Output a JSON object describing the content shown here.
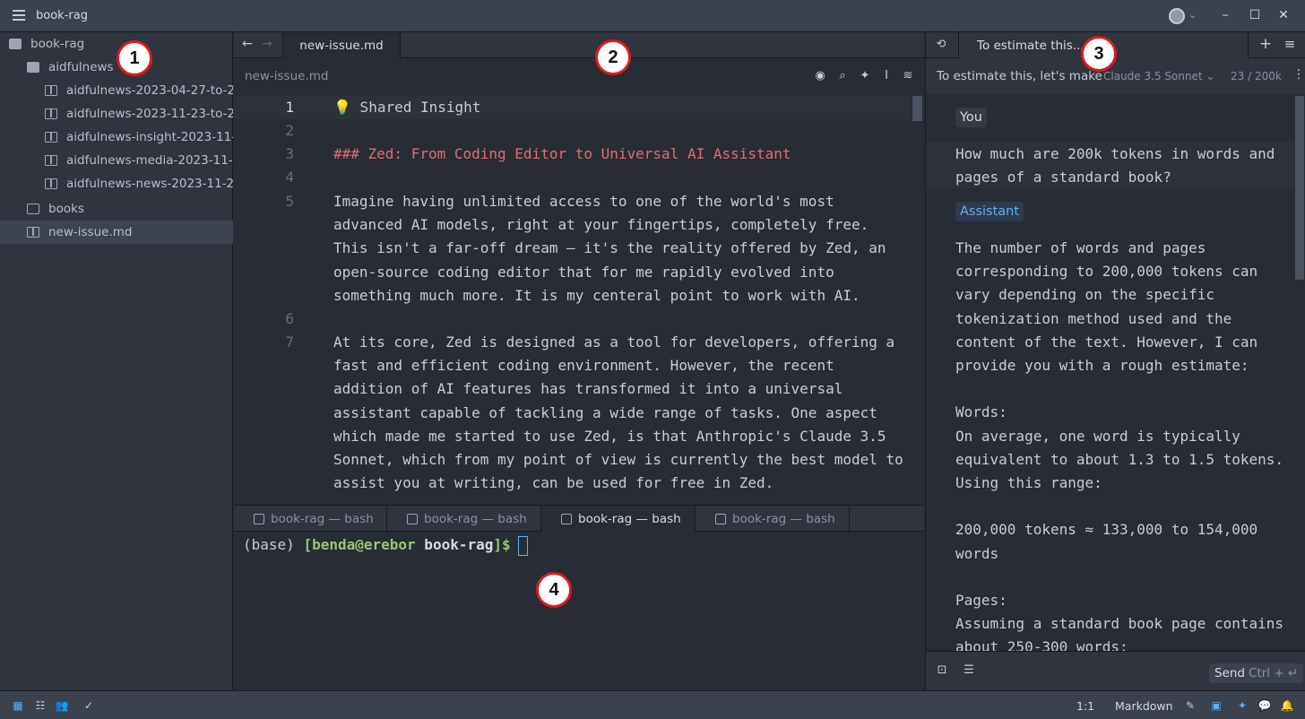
{
  "window": {
    "title": "book-rag"
  },
  "sidebar": {
    "items": [
      {
        "label": "book-rag",
        "kind": "folder"
      },
      {
        "label": "aidfulnews",
        "kind": "folder"
      },
      {
        "label": "aidfulnews-2023-04-27-to-2",
        "kind": "file"
      },
      {
        "label": "aidfulnews-2023-11-23-to-2",
        "kind": "file"
      },
      {
        "label": "aidfulnews-insight-2023-11-",
        "kind": "file"
      },
      {
        "label": "aidfulnews-media-2023-11-2",
        "kind": "file"
      },
      {
        "label": "aidfulnews-news-2023-11-23",
        "kind": "file"
      },
      {
        "label": "books",
        "kind": "folder"
      },
      {
        "label": "new-issue.md",
        "kind": "file"
      }
    ]
  },
  "editor": {
    "tab_label": "new-issue.md",
    "breadcrumb": "new-issue.md",
    "lines": [
      {
        "num": "1",
        "text": "💡 Shared Insight"
      },
      {
        "num": "2",
        "text": ""
      },
      {
        "num": "3",
        "text": "### Zed: From Coding Editor to Universal AI Assistant"
      },
      {
        "num": "4",
        "text": ""
      },
      {
        "num": "5",
        "text": "Imagine having unlimited access to one of the world's most advanced AI models, right at your fingertips, completely free. This isn't a far-off dream – it's the reality offered by Zed, an open-source coding editor that for me rapidly evolved into something much more. It is my centeral point to work with AI."
      },
      {
        "num": "6",
        "text": ""
      },
      {
        "num": "7",
        "text": "At its core, Zed is designed as a tool for developers, offering a fast and efficient coding environment. However, the recent addition of AI features has transformed it into a universal assistant capable of tackling a wide range of tasks. One aspect which made me started to use Zed, is that Anthropic's Claude 3.5 Sonnet, which from my point of view is currently the best model to assist you at writing, can be used for free in Zed."
      }
    ]
  },
  "terminal": {
    "tabs": [
      "book-rag — bash",
      "book-rag — bash",
      "book-rag — bash",
      "book-rag — bash"
    ],
    "prompt_base": "(base) ",
    "prompt_open": "[",
    "prompt_user": "benda@erebor",
    "prompt_dir": " book-rag",
    "prompt_close": "]$"
  },
  "assistant": {
    "tab_label": "To estimate this...",
    "title": "To estimate this, let's make",
    "model": "Claude 3.5 Sonnet",
    "token_count": "23 / 200k",
    "user_role": "You",
    "user_message": "How much are 200k tokens in words and pages of a standard book?",
    "assistant_role": "Assistant",
    "assistant_message": "The number of words and pages corresponding to 200,000 tokens can vary depending on the specific tokenization method used and the content of the text. However, I can provide you with a rough estimate:\n\nWords:\nOn average, one word is typically equivalent to about 1.3 to 1.5 tokens. Using this range:\n\n200,000 tokens ≈ 133,000 to 154,000 words\n\nPages:\nAssuming a standard book page contains about 250-300 words:",
    "send_label": "Send",
    "send_shortcut": "Ctrl + ↵"
  },
  "statusbar": {
    "cursor_position": "1:1",
    "language": "Markdown"
  },
  "badges": [
    "1",
    "2",
    "3",
    "4"
  ]
}
